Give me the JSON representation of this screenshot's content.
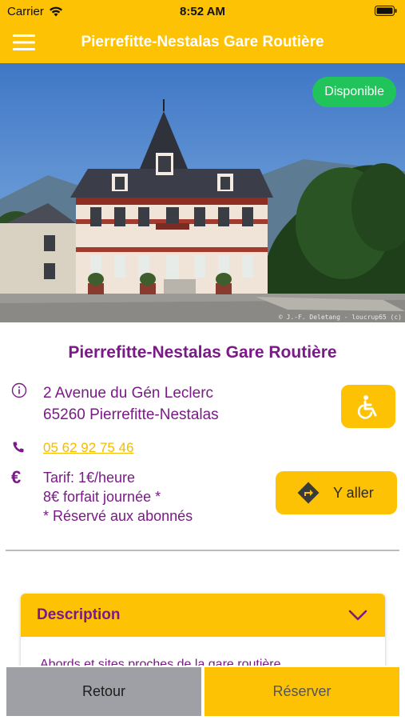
{
  "status_bar": {
    "carrier": "Carrier",
    "time": "8:52 AM"
  },
  "nav": {
    "title": "Pierrefitte-Nestalas Gare Routière"
  },
  "hero": {
    "availability": "Disponible",
    "credit": "© J.-F. Deletang - loucrup65 (c)"
  },
  "station": {
    "name": "Pierrefitte-Nestalas Gare Routière",
    "address_line1": "2 Avenue du Gén Leclerc",
    "address_line2": "65260 Pierrefitte-Nestalas",
    "phone": "05 62 92 75 46",
    "tariff_line1": "Tarif: 1€/heure",
    "tariff_line2": "8€ forfait journée *",
    "tariff_line3": "* Réservé aux abonnés"
  },
  "actions": {
    "go_label": "Y aller"
  },
  "description": {
    "title": "Description",
    "preview": "Abords et sites proches de la gare routière"
  },
  "bottom": {
    "back_label": "Retour",
    "book_label": "Réserver"
  },
  "colors": {
    "accent": "#fcc203",
    "brand_purple": "#7a1a86",
    "available_green": "#21c35b"
  }
}
